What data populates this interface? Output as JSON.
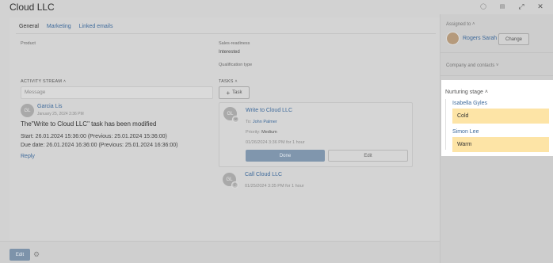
{
  "header": {
    "title": "Cloud LLC"
  },
  "tabs": [
    {
      "label": "General"
    },
    {
      "label": "Marketing"
    },
    {
      "label": "Linked emails"
    }
  ],
  "fields": {
    "product_label": "Product",
    "sales_readiness_label": "Sales-readiness",
    "sales_readiness_value": "Interested",
    "qualification_label": "Qualification type"
  },
  "activity": {
    "section_label": "ACTIVITY STREAM",
    "message_placeholder": "Message",
    "avatar_initials": "GL",
    "user": "Garcia Lis",
    "date": "January 25, 2024 3:36 PM",
    "headline": "The\"Write to Cloud LLC\" task has been modified",
    "start_line": "Start:  26.01.2024 15:36:00 (Previous:  25.01.2024 15:36:00)",
    "due_line": "Due date:  26.01.2024 16:36:00  (Previous: 25.01.2024 16:36:00)",
    "reply": "Reply"
  },
  "tasks": {
    "section_label": "TASKS",
    "add_button": "Task",
    "items": [
      {
        "avatar_initials": "GL",
        "title": "Write to Cloud LLC",
        "to_label": "To:",
        "to_value": "John Palmer",
        "priority_label": "Priority:",
        "priority_value": "Medium",
        "when": "01/26/2024 3:36 PM for 1 hour",
        "done_label": "Done",
        "edit_label": "Edit"
      },
      {
        "avatar_initials": "GL",
        "title": "Call Cloud LLC",
        "when": "01/25/2024 3:35 PM for 1 hour"
      }
    ]
  },
  "footer": {
    "edit_label": "Edit"
  },
  "sidebar": {
    "assigned_label": "Assigned to",
    "assignee": "Rogers Sarah",
    "change_label": "Change",
    "company_label": "Company and contacts",
    "nurturing": {
      "title": "Nurturing stage",
      "entries": [
        {
          "name": "Isabella Gyles",
          "stage": "Cold"
        },
        {
          "name": "Simon Lee",
          "stage": "Warm"
        }
      ]
    }
  },
  "colors": {
    "link": "#3e6a9b",
    "primary_button": "#8096ad",
    "stage_highlight": "#fde4a6"
  }
}
